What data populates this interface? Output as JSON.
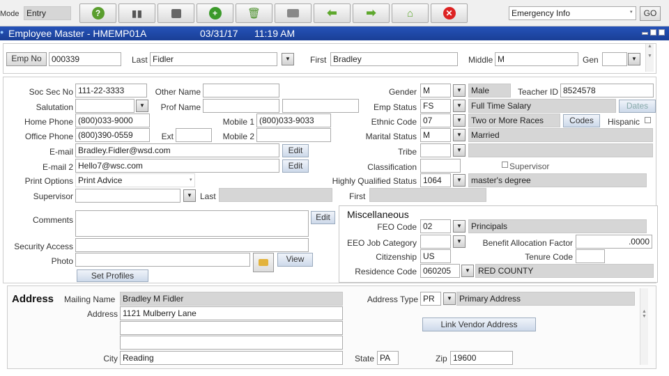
{
  "toolbar": {
    "mode_label": "Mode",
    "mode_value": "Entry",
    "lookup_value": "Emergency Info",
    "go_label": "GO"
  },
  "window": {
    "title": "Employee Master - HMEMP01A",
    "date": "03/31/17",
    "time": "11:19 AM"
  },
  "header": {
    "emp_no_label": "Emp No",
    "emp_no": "000339",
    "last_label": "Last",
    "last": "Fidler",
    "first_label": "First",
    "first": "Bradley",
    "middle_label": "Middle",
    "middle": "M",
    "gen_label": "Gen",
    "gen": ""
  },
  "left": {
    "soc_sec_label": "Soc Sec No",
    "soc_sec": "111-22-3333",
    "other_name_label": "Other Name",
    "other_name": "",
    "salutation_label": "Salutation",
    "salutation": "",
    "prof_name_label": "Prof Name",
    "prof_name_1": "",
    "prof_name_2": "",
    "home_phone_label": "Home Phone",
    "home_phone": "(800)033-9000",
    "mobile1_label": "Mobile 1",
    "mobile1": "(800)033-9033",
    "office_phone_label": "Office Phone",
    "office_phone": "(800)390-0559",
    "ext_label": "Ext",
    "ext": "",
    "mobile2_label": "Mobile 2",
    "mobile2": "",
    "email_label": "E-mail",
    "email": "Bradley.Fidler@wsd.com",
    "email2_label": "E-mail 2",
    "email2": "Hello7@wsc.com",
    "edit_label": "Edit",
    "print_options_label": "Print Options",
    "print_options": "Print Advice",
    "supervisor_label": "Supervisor",
    "supervisor": "",
    "supervisor_last_label": "Last",
    "supervisor_last": "",
    "supervisor_first_label": "First",
    "supervisor_first": "",
    "comments_label": "Comments",
    "comments": "",
    "comments_edit_label": "Edit",
    "security_access_label": "Security Access",
    "security_access": "",
    "photo_label": "Photo",
    "photo": "",
    "view_label": "View",
    "set_profiles_label": "Set Profiles"
  },
  "right": {
    "gender_label": "Gender",
    "gender": "M",
    "gender_desc": "Male",
    "teacher_id_label": "Teacher ID",
    "teacher_id": "8524578",
    "emp_status_label": "Emp Status",
    "emp_status": "FS",
    "emp_status_desc": "Full Time Salary",
    "dates_label": "Dates",
    "ethnic_code_label": "Ethnic Code",
    "ethnic_code": "07",
    "ethnic_desc": "Two or More Races",
    "codes_label": "Codes",
    "hispanic_label": "Hispanic",
    "marital_status_label": "Marital Status",
    "marital_status": "M",
    "marital_desc": "Married",
    "tribe_label": "Tribe",
    "tribe": "",
    "tribe_desc": "",
    "classification_label": "Classification",
    "classification": "",
    "supervisor_chk_label": "Supervisor",
    "hq_status_label": "Highly Qualified Status",
    "hq_status": "1064",
    "hq_desc": "master's degree"
  },
  "misc": {
    "title": "Miscellaneous",
    "feo_code_label": "FEO Code",
    "feo_code": "02",
    "feo_desc": "Principals",
    "eeo_job_label": "EEO Job Category",
    "eeo_job": "",
    "benefit_alloc_label": "Benefit Allocation Factor",
    "benefit_alloc": ".0000",
    "citizenship_label": "Citizenship",
    "citizenship": "US",
    "tenure_label": "Tenure Code",
    "tenure": "",
    "residence_label": "Residence Code",
    "residence": "060205",
    "residence_desc": "RED COUNTY"
  },
  "address": {
    "title": "Address",
    "mailing_name_label": "Mailing Name",
    "mailing_name": "Bradley M Fidler",
    "address_label": "Address",
    "line1": "1121 Mulberry Lane",
    "line2": "",
    "line3": "",
    "city_label": "City",
    "city": "Reading",
    "state_label": "State",
    "state": "PA",
    "zip_label": "Zip",
    "zip": "19600",
    "address_type_label": "Address Type",
    "address_type": "PR",
    "address_type_desc": "Primary Address",
    "link_vendor_label": "Link Vendor Address"
  },
  "colors": {
    "title_bar": "#1f4aa8",
    "readonly": "#d6d6d6"
  }
}
